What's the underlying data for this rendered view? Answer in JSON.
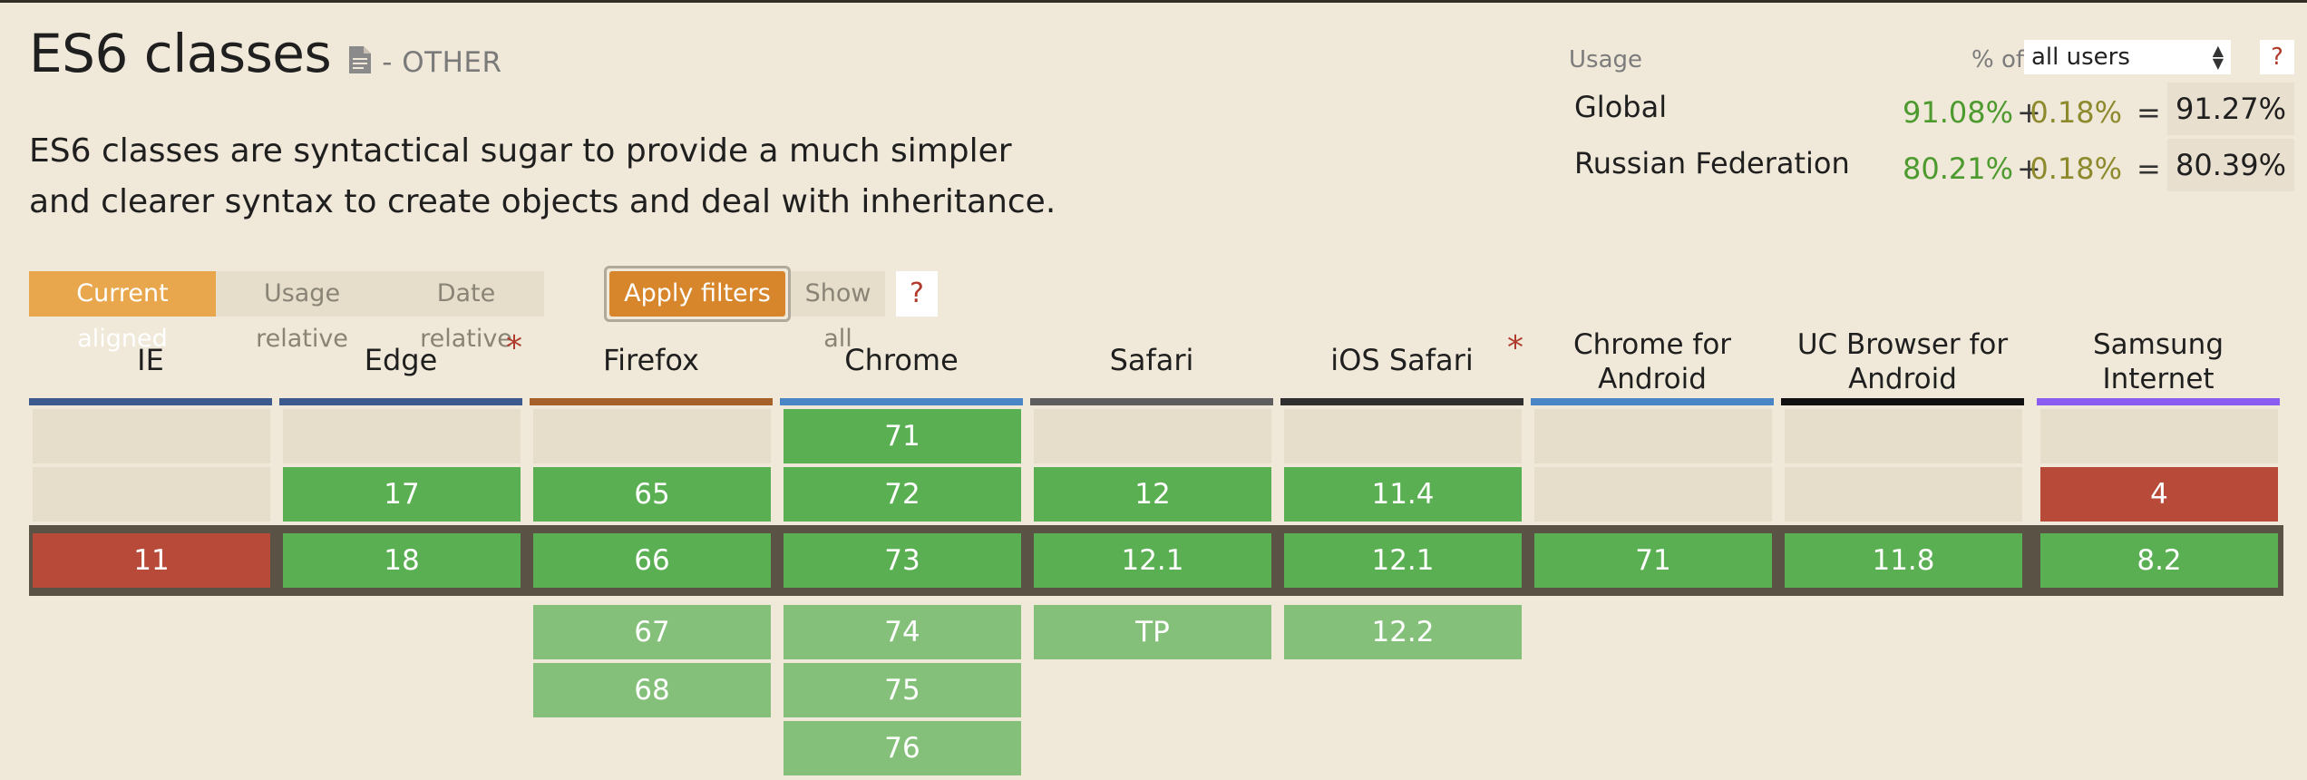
{
  "feature": {
    "title": "ES6 classes",
    "icon": "document-icon",
    "category": "- OTHER",
    "description": "ES6 classes are syntactical sugar to provide a much simpler and clearer syntax to create objects and deal with inheritance."
  },
  "usage": {
    "label": "Usage",
    "pct_of_label": "% of",
    "select_value": "all users",
    "help": "?",
    "rows": [
      {
        "region": "Global",
        "supported": "91.08%",
        "plus": "+",
        "partial": "0.18%",
        "eq": "=",
        "total": "91.27%"
      },
      {
        "region": "Russian Federation",
        "supported": "80.21%",
        "plus": "+",
        "partial": "0.18%",
        "eq": "=",
        "total": "80.39%"
      }
    ]
  },
  "filters": {
    "current_aligned": "Current aligned",
    "usage_relative": "Usage relative",
    "date_relative": "Date relative",
    "apply": "Apply filters",
    "show_all": "Show all",
    "help": "?"
  },
  "colors": {
    "supported": "#5aaf52",
    "not_supported": "#b84a3a",
    "future": "#84c07a",
    "empty": "#e6ddcb",
    "accent": "#d8862c"
  },
  "browsers": [
    {
      "name": "IE",
      "bar": "#3d5a8e",
      "asterisk": false,
      "cells": [
        [
          "",
          "empty"
        ],
        [
          "",
          "empty"
        ],
        [
          "11",
          "n"
        ]
      ],
      "future": []
    },
    {
      "name": "Edge",
      "bar": "#3d5a8e",
      "asterisk": true,
      "cells": [
        [
          "",
          "empty"
        ],
        [
          "17",
          "y"
        ],
        [
          "18",
          "y"
        ]
      ],
      "future": []
    },
    {
      "name": "Firefox",
      "bar": "#a6602a",
      "asterisk": false,
      "cells": [
        [
          "",
          "empty"
        ],
        [
          "65",
          "y"
        ],
        [
          "66",
          "y"
        ]
      ],
      "future": [
        "67",
        "68"
      ]
    },
    {
      "name": "Chrome",
      "bar": "#4a86c5",
      "asterisk": false,
      "cells": [
        [
          "71",
          "y"
        ],
        [
          "72",
          "y"
        ],
        [
          "73",
          "y"
        ]
      ],
      "future": [
        "74",
        "75",
        "76"
      ]
    },
    {
      "name": "Safari",
      "bar": "#5e5e5e",
      "asterisk": false,
      "cells": [
        [
          "",
          "empty"
        ],
        [
          "12",
          "y"
        ],
        [
          "12.1",
          "y"
        ]
      ],
      "future": [
        "TP"
      ]
    },
    {
      "name": "iOS Safari",
      "bar": "#2f2f2f",
      "asterisk": true,
      "cells": [
        [
          "",
          "empty"
        ],
        [
          "11.4",
          "y"
        ],
        [
          "12.1",
          "y"
        ]
      ],
      "future": [
        "12.2"
      ]
    },
    {
      "name": "Chrome for Android",
      "bar": "#4a86c5",
      "asterisk": false,
      "cells": [
        [
          "",
          "empty"
        ],
        [
          "",
          "empty"
        ],
        [
          "71",
          "y"
        ]
      ],
      "future": []
    },
    {
      "name": "UC Browser for Android",
      "bar": "#111111",
      "asterisk": false,
      "cells": [
        [
          "",
          "empty"
        ],
        [
          "",
          "empty"
        ],
        [
          "11.8",
          "y"
        ]
      ],
      "future": []
    },
    {
      "name": "Samsung Internet",
      "bar": "#8b5cf0",
      "asterisk": false,
      "cells": [
        [
          "",
          "empty"
        ],
        [
          "4",
          "n"
        ],
        [
          "8.2",
          "y"
        ]
      ],
      "future": []
    }
  ]
}
